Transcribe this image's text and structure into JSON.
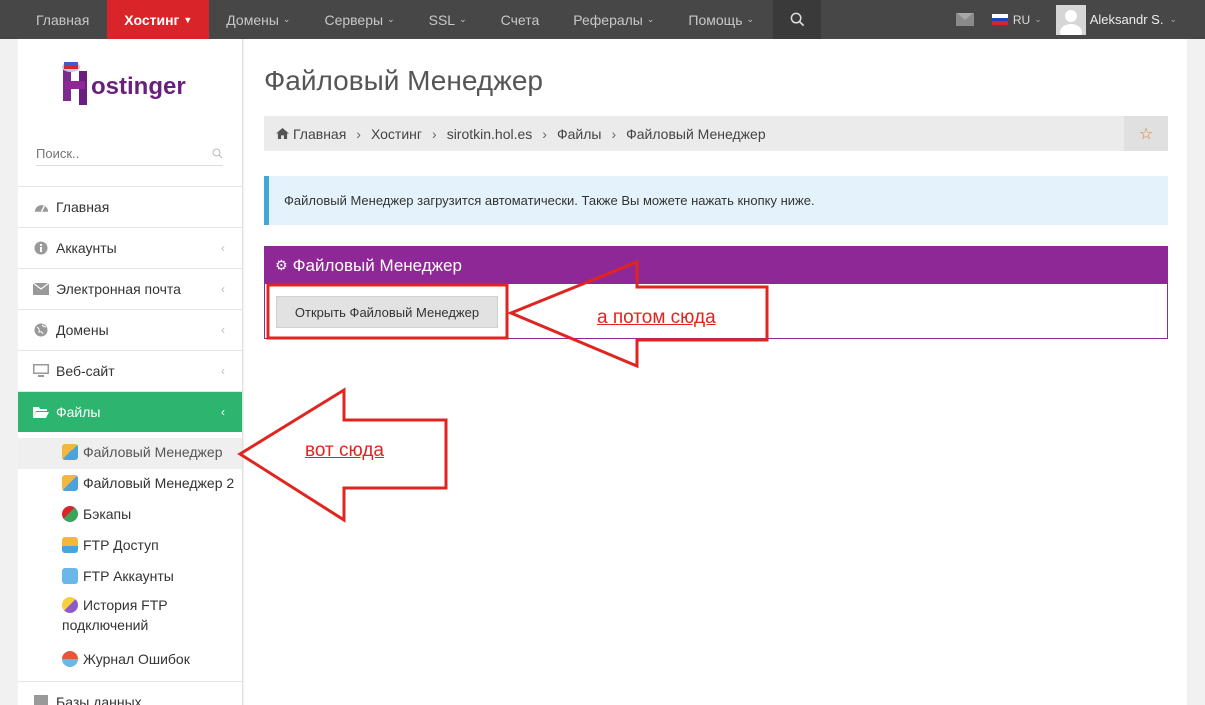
{
  "topnav": {
    "items": [
      {
        "label": "Главная",
        "caret": false,
        "active": false
      },
      {
        "label": "Хостинг",
        "caret": true,
        "active": true
      },
      {
        "label": "Домены",
        "caret": true,
        "active": false
      },
      {
        "label": "Серверы",
        "caret": true,
        "active": false
      },
      {
        "label": "SSL",
        "caret": true,
        "active": false
      },
      {
        "label": "Счета",
        "caret": false,
        "active": false
      },
      {
        "label": "Рефералы",
        "caret": true,
        "active": false
      },
      {
        "label": "Помощь",
        "caret": true,
        "active": false
      }
    ],
    "search_icon": "search-icon",
    "language": "RU",
    "username": "Aleksandr S.",
    "colors": {
      "bar": "#474747",
      "active": "#d9252a"
    }
  },
  "sidebar": {
    "logo_text": "ostinger",
    "search_placeholder": "Поиск..",
    "menu": [
      {
        "label": "Главная",
        "icon": "dashboard-icon",
        "arrow": false
      },
      {
        "label": "Аккаунты",
        "icon": "info-icon",
        "arrow": true
      },
      {
        "label": "Электронная почта",
        "icon": "mail-icon",
        "arrow": true
      },
      {
        "label": "Домены",
        "icon": "globe-icon",
        "arrow": true
      },
      {
        "label": "Веб-сайт",
        "icon": "monitor-icon",
        "arrow": true
      },
      {
        "label": "Файлы",
        "icon": "folder-open-icon",
        "arrow": true,
        "active": true
      }
    ],
    "submenu": [
      {
        "label": "Файловый Менеджер",
        "active": true
      },
      {
        "label": "Файловый Менеджер 2"
      },
      {
        "label": "Бэкапы"
      },
      {
        "label": "FTP Доступ"
      },
      {
        "label": "FTP Аккаунты"
      },
      {
        "label": "История FTP",
        "label2": "подключений"
      },
      {
        "label": "Журнал Ошибок"
      }
    ],
    "after_menu": {
      "label": "Базы данных",
      "icon": "database-icon"
    },
    "active_color": "#2db56f"
  },
  "main": {
    "title": "Файловый Менеджер",
    "breadcrumb": [
      "Главная",
      "Хостинг",
      "sirotkin.hol.es",
      "Файлы",
      "Файловый Менеджер"
    ],
    "info": "Файловый Менеджер загрузится автоматически. Также Вы можете нажать кнопку ниже.",
    "panel_title": "Файловый Менеджер",
    "open_button": "Открыть Файловый Менеджер",
    "panel_color": "#8e2896"
  },
  "annotations": {
    "first": "вот сюда",
    "second": "а потом сюда",
    "color": "#e0241f"
  }
}
